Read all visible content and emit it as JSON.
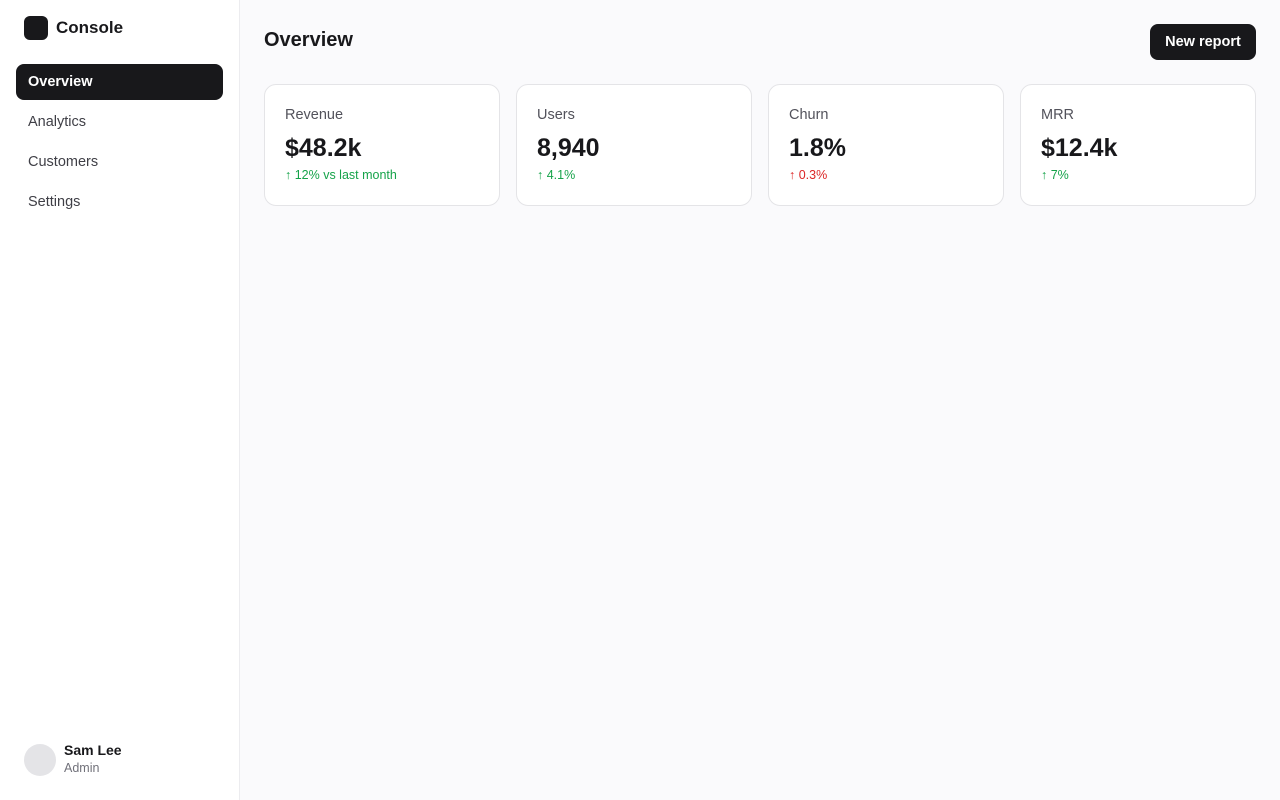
{
  "app": {
    "name": "Console"
  },
  "sidebar": {
    "items": [
      {
        "label": "Overview",
        "active": true
      },
      {
        "label": "Analytics",
        "active": false
      },
      {
        "label": "Customers",
        "active": false
      },
      {
        "label": "Settings",
        "active": false
      }
    ]
  },
  "user": {
    "name": "Sam Lee",
    "role": "Admin"
  },
  "header": {
    "title": "Overview",
    "new_report_label": "New report"
  },
  "metrics": [
    {
      "label": "Revenue",
      "value": "$48.2k",
      "delta": "↑ 12% vs last month",
      "trend": "up"
    },
    {
      "label": "Users",
      "value": "8,940",
      "delta": "↑ 4.1%",
      "trend": "up"
    },
    {
      "label": "Churn",
      "value": "1.8%",
      "delta": "↑ 0.3%",
      "trend": "bad"
    },
    {
      "label": "MRR",
      "value": "$12.4k",
      "delta": "↑ 7%",
      "trend": "up"
    }
  ],
  "colors": {
    "accent": "#18181b",
    "positive": "#16a34a",
    "negative": "#dc2626",
    "background": "#fafafc"
  }
}
